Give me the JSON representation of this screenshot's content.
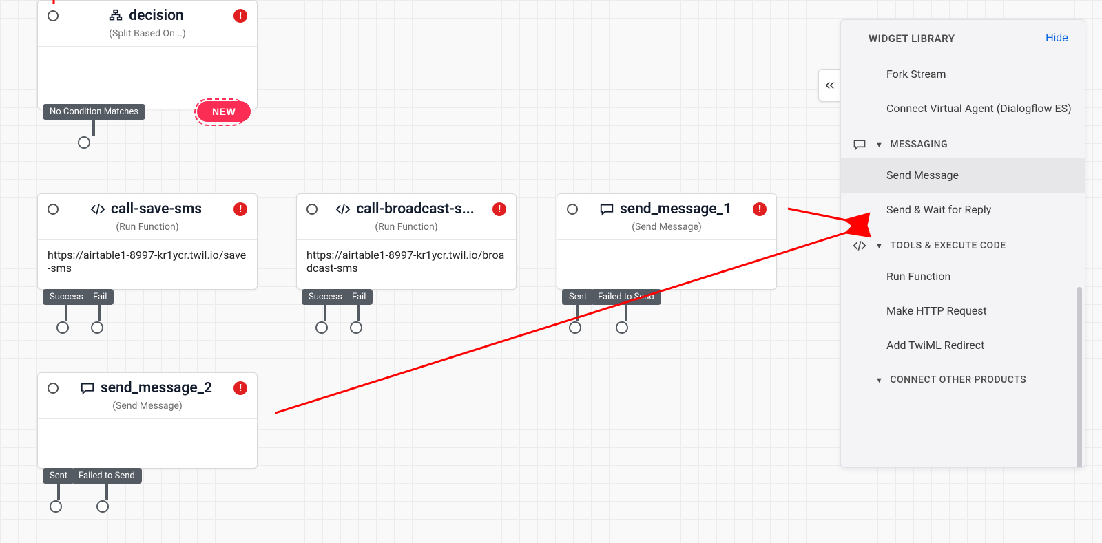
{
  "canvas": {
    "nodes": {
      "decision": {
        "title": "decision",
        "subtitle": "(Split Based On...)",
        "transitions": {
          "no_match": "No Condition Matches"
        },
        "new_badge": "NEW"
      },
      "call_save_sms": {
        "title": "call-save-sms",
        "subtitle": "(Run Function)",
        "body": "https://airtable1-8997-kr1ycr.twil.io/save-sms",
        "transitions": {
          "success": "Success",
          "fail": "Fail"
        }
      },
      "call_broadcast": {
        "title": "call-broadcast-s...",
        "subtitle": "(Run Function)",
        "body": "https://airtable1-8997-kr1ycr.twil.io/broadcast-sms",
        "transitions": {
          "success": "Success",
          "fail": "Fail"
        }
      },
      "send_message_1": {
        "title": "send_message_1",
        "subtitle": "(Send Message)",
        "transitions": {
          "sent": "Sent",
          "failed": "Failed to Send"
        }
      },
      "send_message_2": {
        "title": "send_message_2",
        "subtitle": "(Send Message)",
        "transitions": {
          "sent": "Sent",
          "failed": "Failed to Send"
        }
      }
    }
  },
  "panel": {
    "title": "WIDGET LIBRARY",
    "hide": "Hide",
    "items": {
      "fork_stream": "Fork Stream",
      "connect_va": "Connect Virtual Agent (Dialogflow ES)"
    },
    "sections": {
      "messaging": {
        "label": "MESSAGING",
        "items": {
          "send_message": "Send Message",
          "send_wait": "Send & Wait for Reply"
        }
      },
      "tools": {
        "label": "TOOLS & EXECUTE CODE",
        "items": {
          "run_function": "Run Function",
          "make_http": "Make HTTP Request",
          "add_twiml": "Add TwiML Redirect"
        }
      },
      "connect_other": {
        "label": "CONNECT OTHER PRODUCTS"
      }
    }
  }
}
